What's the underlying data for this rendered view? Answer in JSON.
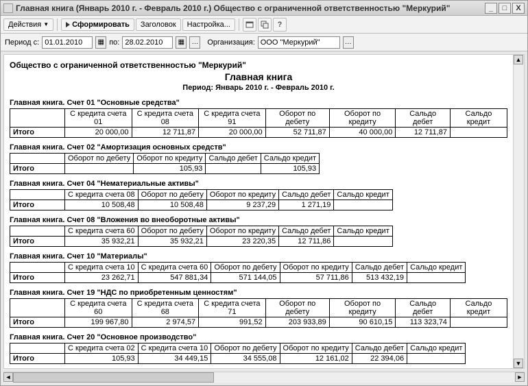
{
  "window": {
    "title": "Главная книга (Январь 2010 г. - Февраль 2010 г.) Общество с ограниченной ответственностью \"Меркурий\"",
    "minimize": "_",
    "maximize": "□",
    "close": "X"
  },
  "toolbar": {
    "actions_label": "Действия",
    "generate_label": "Сформировать",
    "header_label": "Заголовок",
    "settings_label": "Настройка...",
    "help_label": "?"
  },
  "filter": {
    "period_from_label": "Период с:",
    "period_from_value": "01.01.2010",
    "period_to_label": "по:",
    "period_to_value": "28.02.2010",
    "org_label": "Организация:",
    "org_value": "ООО \"Меркурий\""
  },
  "doc": {
    "org_full": "Общество с ограниченной ответственностью \"Меркурий\"",
    "title": "Главная книга",
    "period": "Период: Январь 2010 г. - Февраль 2010 г."
  },
  "cols": {
    "credit_01": "С кредита счета 01",
    "credit_08": "С кредита счета 08",
    "credit_91": "С кредита счета 91",
    "credit_60": "С кредита счета 60",
    "credit_10": "С кредита счета 10",
    "credit_68": "С кредита счета 68",
    "credit_71": "С кредита счета 71",
    "credit_02": "С кредита счета 02",
    "oborot_debet": "Оборот по дебету",
    "oborot_kredit": "Оборот по кредиту",
    "saldo_debet": "Сальдо дебет",
    "saldo_kredit": "Сальдо кредит",
    "itogo": "Итого"
  },
  "sections": [
    {
      "title": "Главная книга. Счет 01 \"Основные средства\"",
      "headers": [
        "credit_01",
        "credit_08",
        "credit_91",
        "oborot_debet",
        "oborot_kredit",
        "saldo_debet",
        "saldo_kredit"
      ],
      "row": [
        "20 000,00",
        "12 711,87",
        "20 000,00",
        "52 711,87",
        "40 000,00",
        "12 711,87",
        ""
      ]
    },
    {
      "title": "Главная книга. Счет 02 \"Амортизация основных средств\"",
      "headers": [
        "oborot_debet",
        "oborot_kredit",
        "saldo_debet",
        "saldo_kredit"
      ],
      "row": [
        "",
        "105,93",
        "",
        "105,93"
      ]
    },
    {
      "title": "Главная книга. Счет 04 \"Нематериальные активы\"",
      "headers": [
        "credit_08",
        "oborot_debet",
        "oborot_kredit",
        "saldo_debet",
        "saldo_kredit"
      ],
      "row": [
        "10 508,48",
        "10 508,48",
        "9 237,29",
        "1 271,19",
        ""
      ]
    },
    {
      "title": "Главная книга. Счет 08 \"Вложения во внеоборотные активы\"",
      "headers": [
        "credit_60",
        "oborot_debet",
        "oborot_kredit",
        "saldo_debet",
        "saldo_kredit"
      ],
      "row": [
        "35 932,21",
        "35 932,21",
        "23 220,35",
        "12 711,86",
        ""
      ]
    },
    {
      "title": "Главная книга. Счет 10 \"Материалы\"",
      "headers": [
        "credit_10",
        "credit_60",
        "oborot_debet",
        "oborot_kredit",
        "saldo_debet",
        "saldo_kredit"
      ],
      "row": [
        "23 262,71",
        "547 881,34",
        "571 144,05",
        "57 711,86",
        "513 432,19",
        ""
      ]
    },
    {
      "title": "Главная книга. Счет 19 \"НДС по приобретенным ценностям\"",
      "headers": [
        "credit_60",
        "credit_68",
        "credit_71",
        "oborot_debet",
        "oborot_kredit",
        "saldo_debet",
        "saldo_kredit"
      ],
      "row": [
        "199 967,80",
        "2 974,57",
        "991,52",
        "203 933,89",
        "90 610,15",
        "113 323,74",
        ""
      ]
    },
    {
      "title": "Главная книга. Счет 20 \"Основное производство\"",
      "headers": [
        "credit_02",
        "credit_10",
        "oborot_debet",
        "oborot_kredit",
        "saldo_debet",
        "saldo_kredit"
      ],
      "row": [
        "105,93",
        "34 449,15",
        "34 555,08",
        "12 161,02",
        "22 394,06",
        ""
      ]
    }
  ]
}
